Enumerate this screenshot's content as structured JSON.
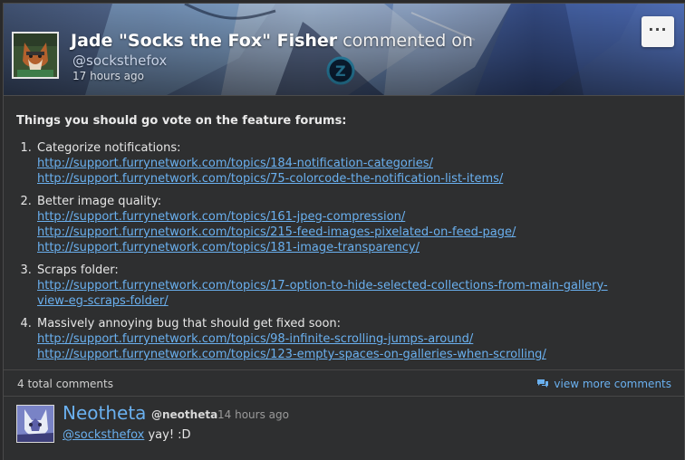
{
  "post": {
    "author_name": "Jade \"Socks the Fox\" Fisher",
    "verb": "commented on",
    "author_handle": "@socksthefox",
    "timestamp": "17 hours ago",
    "menu_label": "···"
  },
  "body": {
    "intro": "Things you should go vote on the feature forums:",
    "items": [
      {
        "label": "Categorize notifications:",
        "links": [
          "http://support.furrynetwork.com/topics/184-notification-categories/",
          "http://support.furrynetwork.com/topics/75-colorcode-the-notification-list-items/"
        ]
      },
      {
        "label": "Better image quality:",
        "links": [
          "http://support.furrynetwork.com/topics/161-jpeg-compression/",
          "http://support.furrynetwork.com/topics/215-feed-images-pixelated-on-feed-page/",
          "http://support.furrynetwork.com/topics/181-image-transparency/"
        ]
      },
      {
        "label": "Scraps folder:",
        "links": [
          "http://support.furrynetwork.com/topics/17-option-to-hide-selected-collections-from-main-gallery-",
          "view-eg-scraps-folder/"
        ]
      },
      {
        "label": "Massively annoying bug that should get fixed soon:",
        "links": [
          "http://support.furrynetwork.com/topics/98-infinite-scrolling-jumps-around/",
          "http://support.furrynetwork.com/topics/123-empty-spaces-on-galleries-when-scrolling/"
        ]
      }
    ]
  },
  "footer": {
    "total_comments": "4 total comments",
    "view_more": "view more comments",
    "view_more_icon": "comments-icon"
  },
  "comment": {
    "name": "Neotheta",
    "handle": "@neotheta",
    "timestamp": "14 hours ago",
    "mention": "@socksthefox",
    "text": " yay! :D"
  },
  "colors": {
    "background": "#2e2f30",
    "link": "#6ab0ef",
    "text": "#e6e6e6"
  }
}
